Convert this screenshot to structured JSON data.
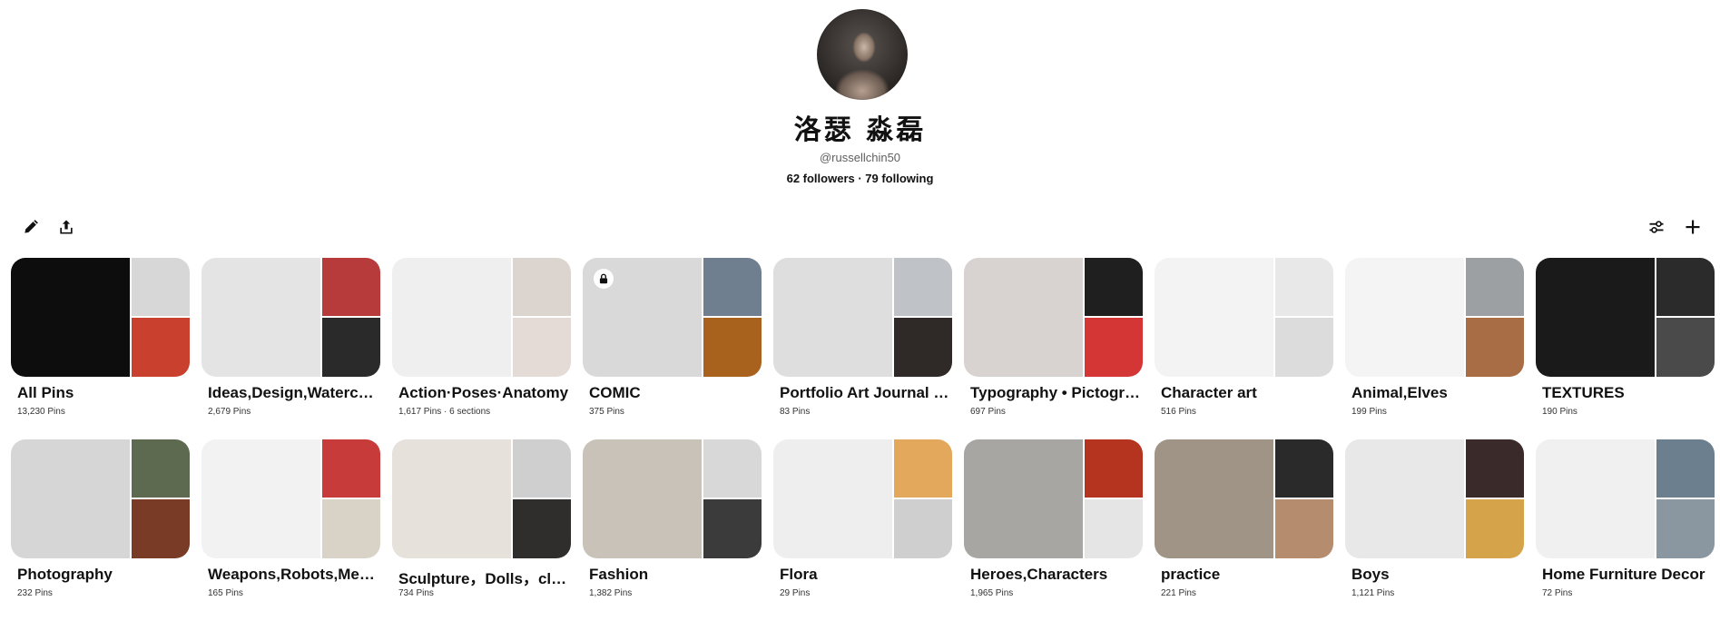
{
  "profile": {
    "name": "洛瑟 淼磊",
    "handle": "@russellchin50",
    "stats": "62 followers · 79 following"
  },
  "toolbar": {
    "left": [
      {
        "name": "edit-button",
        "icon": "pencil-icon"
      },
      {
        "name": "share-button",
        "icon": "upload-icon"
      }
    ],
    "right": [
      {
        "name": "filter-button",
        "icon": "sliders-icon"
      },
      {
        "name": "create-button",
        "icon": "plus-icon"
      }
    ]
  },
  "boards": [
    {
      "title": "All Pins",
      "meta": "13,230 Pins",
      "colors": [
        "#0d0d0d",
        "#d7d7d7",
        "#c9402f"
      ]
    },
    {
      "title": "Ideas,Design,Watercolor",
      "meta": "2,679 Pins",
      "colors": [
        "#e4e4e4",
        "#b83b3b",
        "#2a2a2a"
      ]
    },
    {
      "title": "Action·Poses·Anatomy",
      "meta": "1,617 Pins · 6 sections",
      "colors": [
        "#efefef",
        "#dcd5cf",
        "#e4dbd6"
      ]
    },
    {
      "title": "COMIC",
      "meta": "375 Pins",
      "colors": [
        "#d9d9d9",
        "#6f7f8f",
        "#a8621d"
      ],
      "locked": true
    },
    {
      "title": "Portfolio Art Journal Sketchbook",
      "meta": "83 Pins",
      "colors": [
        "#dedede",
        "#bfc3c7",
        "#2f2a28"
      ]
    },
    {
      "title": "Typography • Pictograms",
      "meta": "697 Pins",
      "colors": [
        "#d8d3d0",
        "#1f1f1f",
        "#d43636"
      ]
    },
    {
      "title": "Character art",
      "meta": "516 Pins",
      "colors": [
        "#f3f3f3",
        "#e8e8e8",
        "#dcdcdc"
      ]
    },
    {
      "title": "Animal,Elves",
      "meta": "199 Pins",
      "colors": [
        "#f4f4f4",
        "#9da0a3",
        "#a86d45"
      ]
    },
    {
      "title": "TEXTURES",
      "meta": "190 Pins",
      "colors": [
        "#1a1a1a",
        "#2b2b2b",
        "#4a4a4a"
      ]
    },
    {
      "title": "Photography",
      "meta": "232 Pins",
      "colors": [
        "#d6d6d6",
        "#5e6a4f",
        "#7a3b26"
      ]
    },
    {
      "title": "Weapons,Robots,Mechas",
      "meta": "165 Pins",
      "colors": [
        "#f2f2f2",
        "#c73b3b",
        "#d9d3c7"
      ]
    },
    {
      "title": "Sculpture，Dolls，clays",
      "meta": "734 Pins",
      "colors": [
        "#e7e1dc",
        "#cfcfcf",
        "#2f2e2c"
      ]
    },
    {
      "title": "Fashion",
      "meta": "1,382 Pins",
      "colors": [
        "#c9c2b8",
        "#d8d8d8",
        "#3b3b3b"
      ]
    },
    {
      "title": "Flora",
      "meta": "29 Pins",
      "colors": [
        "#eeeeee",
        "#e3a85c",
        "#cfcfcf"
      ]
    },
    {
      "title": "Heroes,Characters",
      "meta": "1,965 Pins",
      "colors": [
        "#a8a6a2",
        "#b5341f",
        "#e5e5e5"
      ]
    },
    {
      "title": "practice",
      "meta": "221 Pins",
      "colors": [
        "#9f9486",
        "#2a2a2a",
        "#b68c6e"
      ]
    },
    {
      "title": "Boys",
      "meta": "1,121 Pins",
      "colors": [
        "#e8e8e8",
        "#3b2a2a",
        "#d4a34a"
      ]
    },
    {
      "title": "Home Furniture Decor",
      "meta": "72 Pins",
      "colors": [
        "#f0f0f0",
        "#6b7f8f",
        "#8a96a0"
      ]
    }
  ]
}
